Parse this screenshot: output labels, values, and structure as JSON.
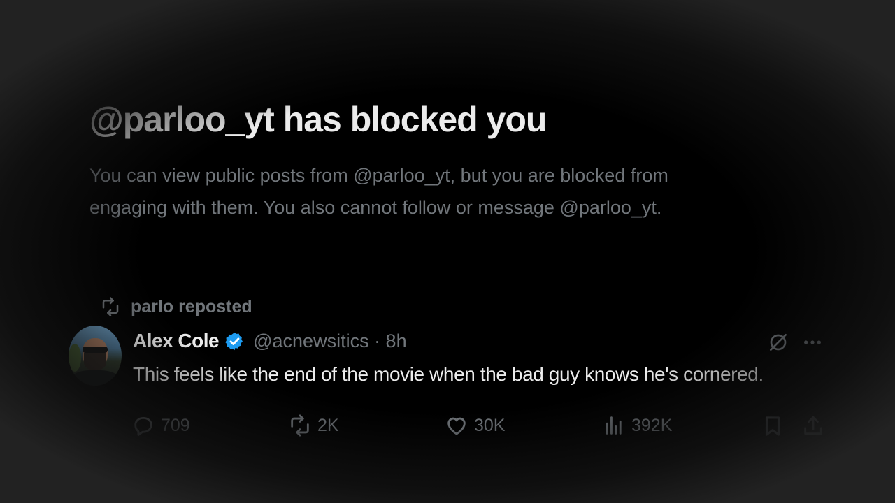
{
  "block_notice": {
    "title": "@parloo_yt has blocked you",
    "description": "You can view public posts from @parloo_yt, but you are blocked from engaging with them. You also cannot follow or message @parloo_yt."
  },
  "post": {
    "repost_label": "parlo reposted",
    "author_name": "Alex Cole",
    "handle_time": "@acnewsitics · 8h",
    "text": "This feels like the end of the movie when the bad guy knows he's cornered.",
    "stats": {
      "replies": "709",
      "reposts": "2K",
      "likes": "30K",
      "views": "392K"
    }
  },
  "colors": {
    "background": "#000000",
    "primary_text": "#ececec",
    "secondary_text": "#71767b",
    "verified_badge": "#1d9bf0"
  },
  "icons": [
    "repost-icon",
    "verified-badge-icon",
    "grok-icon",
    "more-icon",
    "reply-icon",
    "like-icon",
    "views-icon",
    "bookmark-icon",
    "share-icon"
  ]
}
